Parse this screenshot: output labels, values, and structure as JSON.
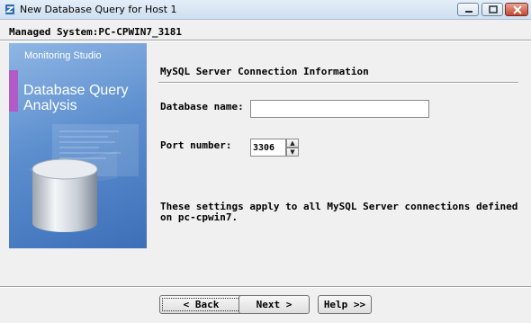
{
  "window": {
    "title": "New Database Query for Host 1",
    "icons": {
      "app": "app-icon",
      "minimize": "minimize-icon",
      "maximize": "maximize-icon",
      "close": "close-icon"
    }
  },
  "header": {
    "system": "Managed System:PC-CPWIN7_3181"
  },
  "banner": {
    "brand": "Monitoring Studio",
    "heading": "Database Query Analysis",
    "colors": {
      "accent": "#b15cc6",
      "background": "#5d8fcf"
    }
  },
  "form": {
    "section_title": "MySQL Server Connection Information",
    "database_label": "Database name:",
    "database_value": "",
    "port_label": "Port number:",
    "port_value": "3306",
    "spin_up": "▲",
    "spin_down": "▼",
    "note": "These settings apply to all MySQL Server connections defined on pc-cpwin7."
  },
  "buttons": {
    "back": "< Back",
    "next": "Next >",
    "help": "Help >>"
  }
}
